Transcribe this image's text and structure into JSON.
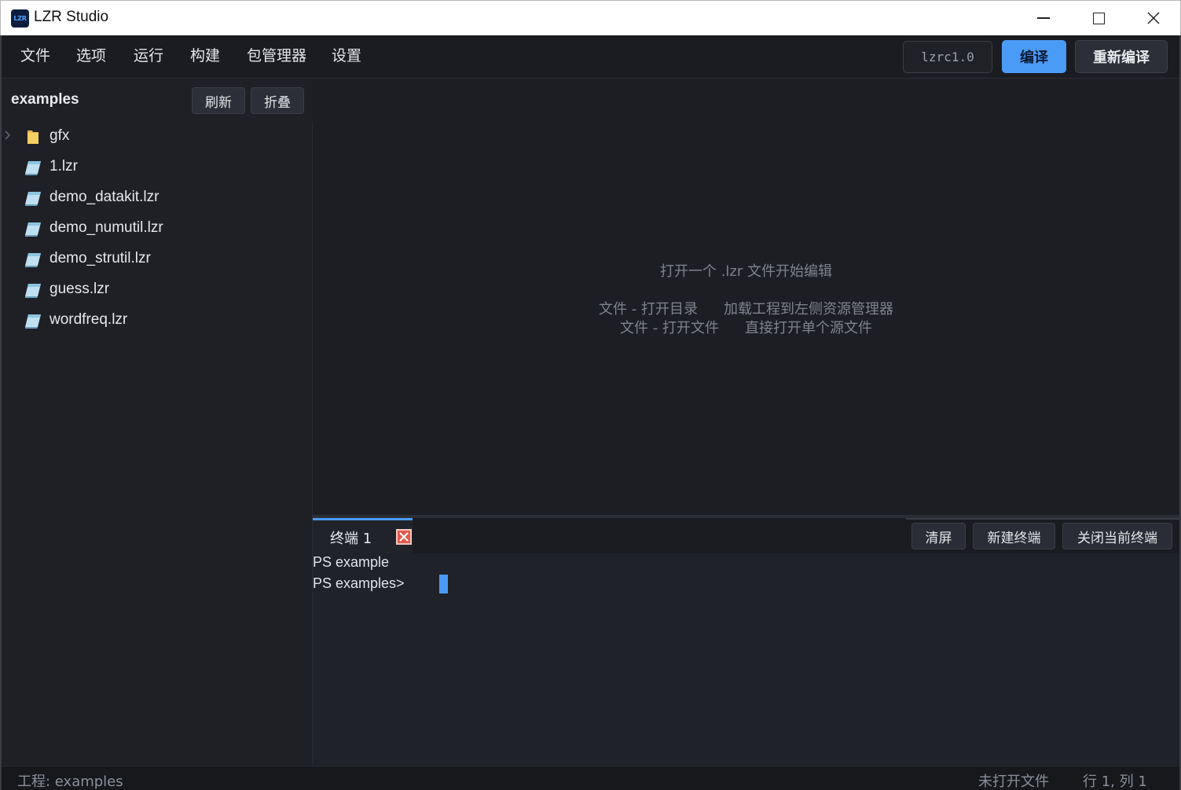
{
  "window": {
    "title": "LZR Studio",
    "icon_text": "LZR",
    "controls": [
      "minimize-icon",
      "maximize-icon",
      "close-icon"
    ]
  },
  "menubar": {
    "items": [
      "文件",
      "选项",
      "运行",
      "构建",
      "包管理器",
      "设置"
    ],
    "compiler_version": "lzrc1.0",
    "compile_label": "编译",
    "recompile_label": "重新编译",
    "accent_color": "#4a9bf5"
  },
  "sidebar": {
    "project_name": "examples",
    "refresh_label": "刷新",
    "collapse_label": "折叠",
    "tree": [
      {
        "label": "gfx",
        "type": "folder",
        "icon": "folder-icon",
        "collapsed": true
      },
      {
        "label": "1.lzr",
        "type": "file",
        "icon": "file-icon"
      },
      {
        "label": "demo_datakit.lzr",
        "type": "file",
        "icon": "file-icon"
      },
      {
        "label": "demo_numutil.lzr",
        "type": "file",
        "icon": "file-icon"
      },
      {
        "label": "demo_strutil.lzr",
        "type": "file",
        "icon": "file-icon"
      },
      {
        "label": "guess.lzr",
        "type": "file",
        "icon": "file-icon"
      },
      {
        "label": "wordfreq.lzr",
        "type": "file",
        "icon": "file-icon"
      }
    ]
  },
  "editor": {
    "empty_title": "打开一个 .lzr 文件开始编辑",
    "hints": [
      {
        "action": "文件 - 打开目录",
        "description": "加载工程到左侧资源管理器"
      },
      {
        "action": "文件 - 打开文件",
        "description": "直接打开单个源文件"
      }
    ]
  },
  "terminal": {
    "tabs": [
      {
        "label": "终端 1",
        "active": true
      }
    ],
    "clear_label": "清屏",
    "new_label": "新建终端",
    "close_label": "关闭当前终端",
    "lines": [
      "PS example",
      "PS examples>"
    ]
  },
  "statusbar": {
    "project": "工程:  examples",
    "file": "未打开文件",
    "position": "行 1, 列 1"
  }
}
